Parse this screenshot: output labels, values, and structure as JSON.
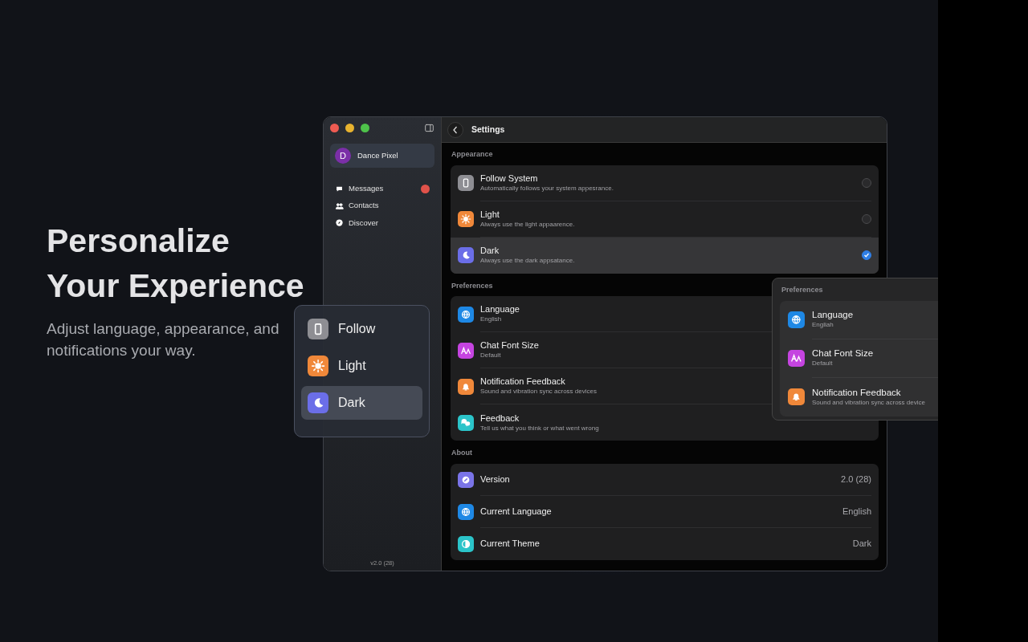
{
  "hero": {
    "title": "Personalize Your Experience",
    "subtitle": "Adjust language, appearance, and notifications your way."
  },
  "window": {
    "title": "Settings"
  },
  "sidebar": {
    "profile": {
      "initial": "D",
      "name": "Dance Pixel",
      "selected": true
    },
    "items": [
      {
        "label": "Messages",
        "badge": true
      },
      {
        "label": "Contacts",
        "badge": false
      },
      {
        "label": "Discover",
        "badge": false
      }
    ],
    "footer": "v2.0 (28)"
  },
  "sections": [
    {
      "title": "Appearance",
      "kind": "radio",
      "rows": [
        {
          "title": "Follow System",
          "subtitle": "Automatically follows your system appesrance.",
          "color": "#8e8e93",
          "selected": false
        },
        {
          "title": "Light",
          "subtitle": "Always use the light appaarence.",
          "color": "#f0883a",
          "selected": false
        },
        {
          "title": "Dark",
          "subtitle": "Always use the dark appsatance.",
          "color": "#6b6ee8",
          "selected": true
        }
      ]
    },
    {
      "title": "Preferences",
      "kind": "nav",
      "rows": [
        {
          "title": "Language",
          "subtitle": "English",
          "color": "#1e88e5"
        },
        {
          "title": "Chat Font Size",
          "subtitle": "Default",
          "color": "#c544e0"
        },
        {
          "title": "Notification Feedback",
          "subtitle": "Sound and vibration sync across devices",
          "color": "#f0883a"
        },
        {
          "title": "Feedback",
          "subtitle": "Tell us what you think or what went wrong",
          "color": "#2bc4c9"
        }
      ]
    },
    {
      "title": "About",
      "kind": "value",
      "rows": [
        {
          "title": "Version",
          "value": "2.0 (28)",
          "color": "#7a74e8"
        },
        {
          "title": "Current Language",
          "value": "English",
          "color": "#1e88e5"
        },
        {
          "title": "Current Theme",
          "value": "Dark",
          "color": "#2bc4c9"
        }
      ]
    }
  ],
  "theme_popover": {
    "items": [
      {
        "label": "Follow",
        "color": "#8e8e93",
        "selected": false
      },
      {
        "label": "Light",
        "color": "#f0883a",
        "selected": false
      },
      {
        "label": "Dark",
        "color": "#6b6ee8",
        "selected": true
      }
    ]
  },
  "preferences_panel": {
    "title": "Preferences",
    "rows": [
      {
        "title": "Language",
        "subtitle": "Engliah",
        "color": "#1e88e5"
      },
      {
        "title": "Chat Font Size",
        "subtitle": "Default",
        "color": "#c544e0"
      },
      {
        "title": "Notification Feedback",
        "subtitle": "Sound and vibration sync across device",
        "color": "#f0883a"
      }
    ]
  }
}
